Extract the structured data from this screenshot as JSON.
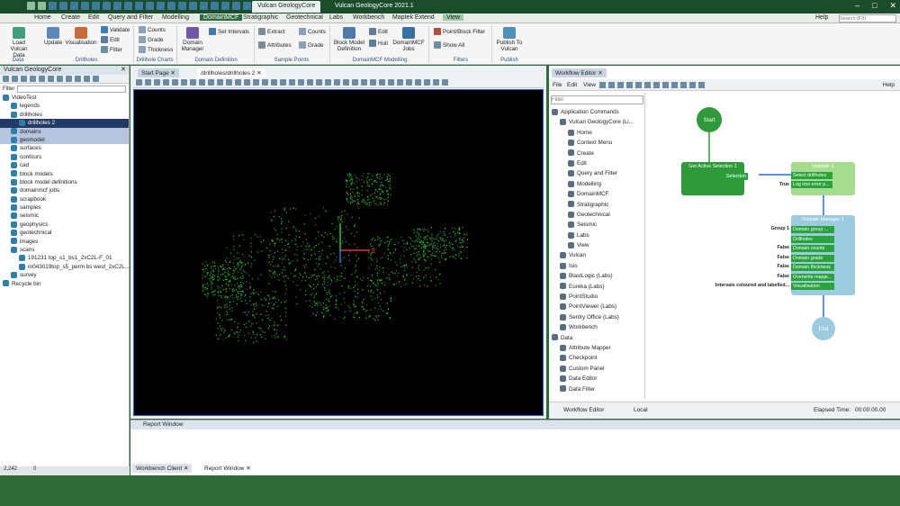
{
  "app": {
    "tab1": "Vulcan GeologyCore",
    "tab2": "Vulcan GeologyCore 2021.1",
    "help": "Help",
    "search_placeholder": "Search (F3)"
  },
  "menu": [
    "Home",
    "Create",
    "Edit",
    "Query and Filter",
    "Modelling",
    "DomainMCF",
    "Stratigraphic",
    "Geotechnical",
    "Labs",
    "Workbench",
    "Maptek Extend",
    "View"
  ],
  "ribbon": {
    "load": "Load Vulcan Data",
    "update": "Update",
    "visualisation": "Visualisation",
    "validate": "Validate",
    "edit": "Edit",
    "filter": "Filter",
    "counts": "Counts",
    "grade": "Grade",
    "thickness": "Thickness",
    "domain_manager": "Domain Manager",
    "set_intervals": "Set Intervals",
    "extract": "Extract",
    "attributes": "Attributes",
    "counts2": "Counts",
    "grade2": "Grade",
    "block_model": "Block Model Definition",
    "edit2": "Edit",
    "hull": "Hull",
    "domainmcf_jobs": "DomainMCF Jobs",
    "point_block_filter": "Point/Block Filter",
    "show_all": "Show All",
    "publish": "Publish To Vulcan",
    "groups": {
      "data": "Data",
      "drillholes": "Drillholes",
      "drillhole_charts": "Drillhole Charts",
      "domain_definition": "Domain Definition",
      "sample_points": "Sample Points",
      "domainmcf_modelling": "DomainMCF Modelling",
      "filters": "Filters",
      "publish": "Publish"
    }
  },
  "left": {
    "title": "Vulcan GeologyCore",
    "filter_label": "Filter",
    "items": [
      {
        "label": "VideoTest",
        "lvl": 0
      },
      {
        "label": "legends",
        "lvl": 1
      },
      {
        "label": "drillholes",
        "lvl": 1
      },
      {
        "label": "drillholes 2",
        "lvl": 2,
        "sel": true
      },
      {
        "label": "domains",
        "lvl": 1,
        "hl": true
      },
      {
        "label": "geomodel",
        "lvl": 1,
        "hl": true
      },
      {
        "label": "surfaces",
        "lvl": 1
      },
      {
        "label": "contours",
        "lvl": 1
      },
      {
        "label": "cad",
        "lvl": 1
      },
      {
        "label": "block models",
        "lvl": 1
      },
      {
        "label": "block model definitions",
        "lvl": 1
      },
      {
        "label": "domainmcf jobs",
        "lvl": 1
      },
      {
        "label": "scrapbook",
        "lvl": 1
      },
      {
        "label": "samples",
        "lvl": 1
      },
      {
        "label": "seismic",
        "lvl": 1
      },
      {
        "label": "geophysics",
        "lvl": 1
      },
      {
        "label": "geotechnical",
        "lvl": 1
      },
      {
        "label": "images",
        "lvl": 1
      },
      {
        "label": "scans",
        "lvl": 1
      },
      {
        "label": "191231 top_s1_bs1_2xC2L-F_01",
        "lvl": 2
      },
      {
        "label": "m043019top_s5_perm bs west_2xC2L...",
        "lvl": 2
      },
      {
        "label": "survey",
        "lvl": 1
      },
      {
        "label": "Recycle bin",
        "lvl": 0
      }
    ],
    "status_a": "2,242",
    "status_b": "0"
  },
  "view": {
    "tab_start": "Start Page",
    "tab_holes": "/drillholes/drillholes 2",
    "axis_n": "N",
    "axis_e": "E"
  },
  "wf": {
    "title": "Workflow Editor",
    "menu": [
      "File",
      "Edit",
      "View"
    ],
    "help": "Help",
    "filter_placeholder": "Filter",
    "tree": [
      {
        "label": "Application Commands",
        "lvl": 0
      },
      {
        "label": "Vulcan GeologyCore (Li...",
        "lvl": 1
      },
      {
        "label": "Home",
        "lvl": 2
      },
      {
        "label": "Context Menu",
        "lvl": 2
      },
      {
        "label": "Create",
        "lvl": 2
      },
      {
        "label": "Edit",
        "lvl": 2
      },
      {
        "label": "Query and Filter",
        "lvl": 2
      },
      {
        "label": "Modelling",
        "lvl": 2
      },
      {
        "label": "DomainMCF",
        "lvl": 2
      },
      {
        "label": "Stratigraphic",
        "lvl": 2
      },
      {
        "label": "Geotechnical",
        "lvl": 2
      },
      {
        "label": "Seismic",
        "lvl": 2
      },
      {
        "label": "Labs",
        "lvl": 2
      },
      {
        "label": "View",
        "lvl": 2
      },
      {
        "label": "Vulcan",
        "lvl": 1
      },
      {
        "label": "Isis",
        "lvl": 1
      },
      {
        "label": "BlastLogic (Labs)",
        "lvl": 1
      },
      {
        "label": "Eureka (Labs)",
        "lvl": 1
      },
      {
        "label": "PointStudio",
        "lvl": 1
      },
      {
        "label": "PointViewer (Labs)",
        "lvl": 1
      },
      {
        "label": "Sentry Office (Labs)",
        "lvl": 1
      },
      {
        "label": "Workbench",
        "lvl": 1
      },
      {
        "label": "Data",
        "lvl": 0
      },
      {
        "label": "Attribute Mapper",
        "lvl": 1
      },
      {
        "label": "Checkpoint",
        "lvl": 1
      },
      {
        "label": "Custom Panel",
        "lvl": 1
      },
      {
        "label": "Data Editor",
        "lvl": 1
      },
      {
        "label": "Data Filter",
        "lvl": 1
      }
    ],
    "start": "Start",
    "end": "End",
    "n1_title": "Get Active Selection 1",
    "n1_pin": "Selection",
    "n2_title": "Validate 1",
    "n2_pins": [
      "Select drillholes",
      "Log one error p..."
    ],
    "n2_true": "True",
    "n3_title": "Domain Manager 1",
    "n3_pins": [
      "Domain group ...",
      "Drillholes",
      "Domain counts",
      "Domain grade",
      "Domain thickness",
      "Overwrite mappi...",
      "Visualisation"
    ],
    "n3_labels": [
      "Group 1",
      "",
      "False",
      "False",
      "False",
      "False",
      "Intervals coloured and labelled..."
    ],
    "footer_tab": "Workflow Editor",
    "footer_local": "Local",
    "elapsed_label": "Elapsed Time:",
    "elapsed": "00:00:00.00"
  },
  "bottom": {
    "report": "Report Window",
    "tab_wb": "Workbench Client",
    "tab_rep": "Report Window"
  },
  "colors": {
    "node_green": "#2e9a3a",
    "node_light": "#a6dc8e",
    "node_blue": "#9ccbe0",
    "accent": "#1b4d2c"
  }
}
